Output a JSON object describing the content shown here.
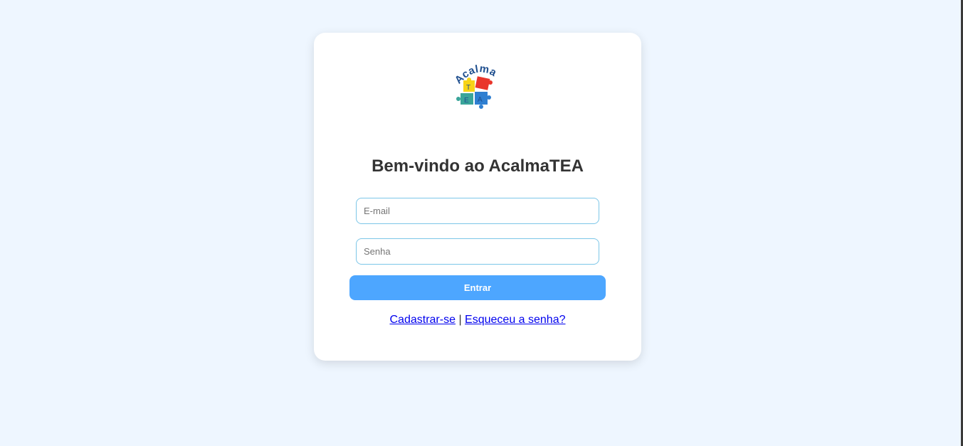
{
  "logo": {
    "text": "Acalma",
    "puzzle_letters": [
      "T",
      "E",
      "A"
    ],
    "colors": {
      "text": "#1f4f8f",
      "yellow": "#f7d417",
      "red": "#e9352b",
      "teal": "#3aa59a",
      "blue": "#2f7fd1"
    }
  },
  "login": {
    "title": "Bem-vindo ao AcalmaTEA",
    "email_placeholder": "E-mail",
    "password_placeholder": "Senha",
    "submit_label": "Entrar",
    "register_link": "Cadastrar-se",
    "separator": "|",
    "forgot_link": "Esqueceu a senha?"
  },
  "colors": {
    "background": "#eef6ff",
    "card": "#ffffff",
    "button": "#4da6ff",
    "input_border": "#7cc6e8",
    "link": "#0000ee"
  }
}
